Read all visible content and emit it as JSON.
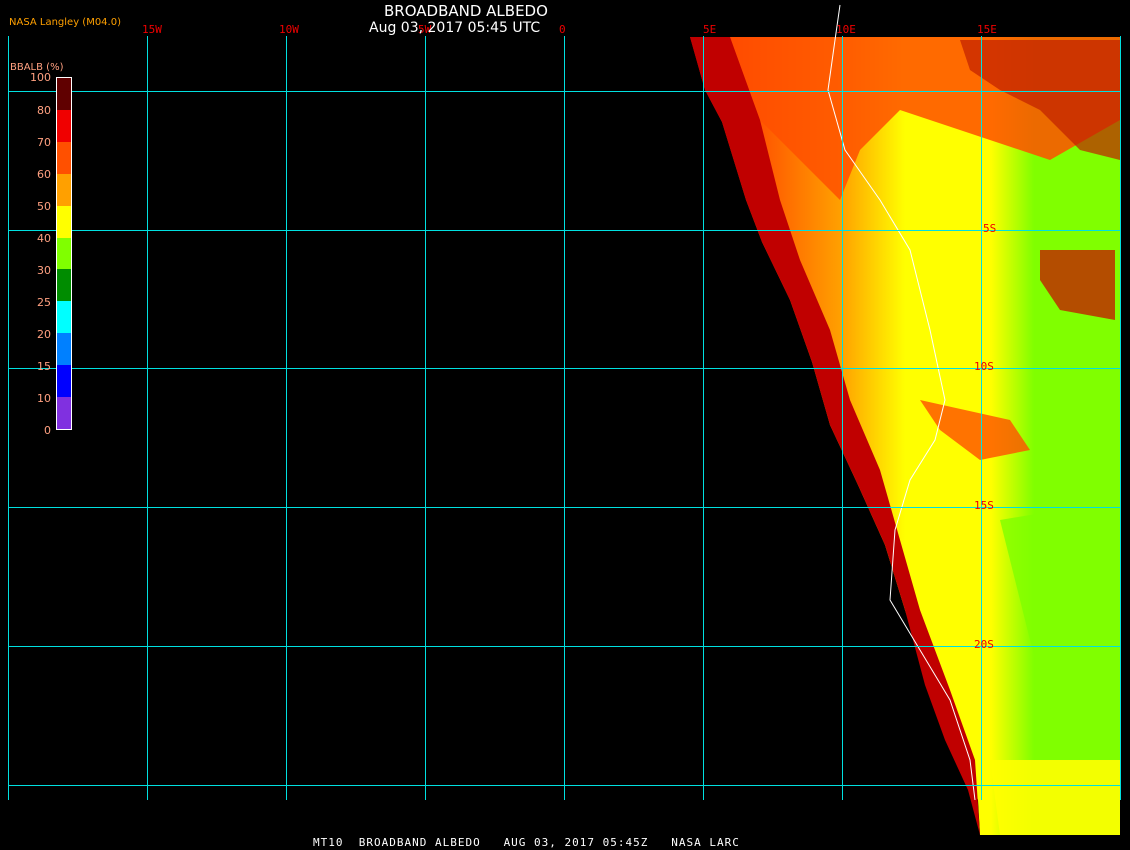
{
  "header": {
    "title": "BROADBAND ALBEDO",
    "datetime": "Aug 03, 2017 05:45 UTC",
    "credit": "NASA Langley (M04.0)"
  },
  "grid": {
    "longitude_labels": [
      "15W",
      "10W",
      "5W",
      "0",
      "5E",
      "10E",
      "15E"
    ],
    "latitude_labels": [
      "5S",
      "10S",
      "15S",
      "20S"
    ],
    "line_color": "#00e0e0"
  },
  "legend": {
    "title": "BBALB (%)",
    "tick_labels": [
      "100",
      "80",
      "70",
      "60",
      "50",
      "40",
      "30",
      "25",
      "20",
      "15",
      "10",
      "0"
    ],
    "colors": [
      "#600000",
      "#f00000",
      "#ff5000",
      "#ffa000",
      "#ffff00",
      "#80ff00",
      "#008c00",
      "#00ffff",
      "#0080ff",
      "#0000ff",
      "#8030e0"
    ]
  },
  "footer": {
    "text": "MT10  BROADBAND ALBEDO   AUG 03, 2017 05:45Z   NASA LARC"
  }
}
